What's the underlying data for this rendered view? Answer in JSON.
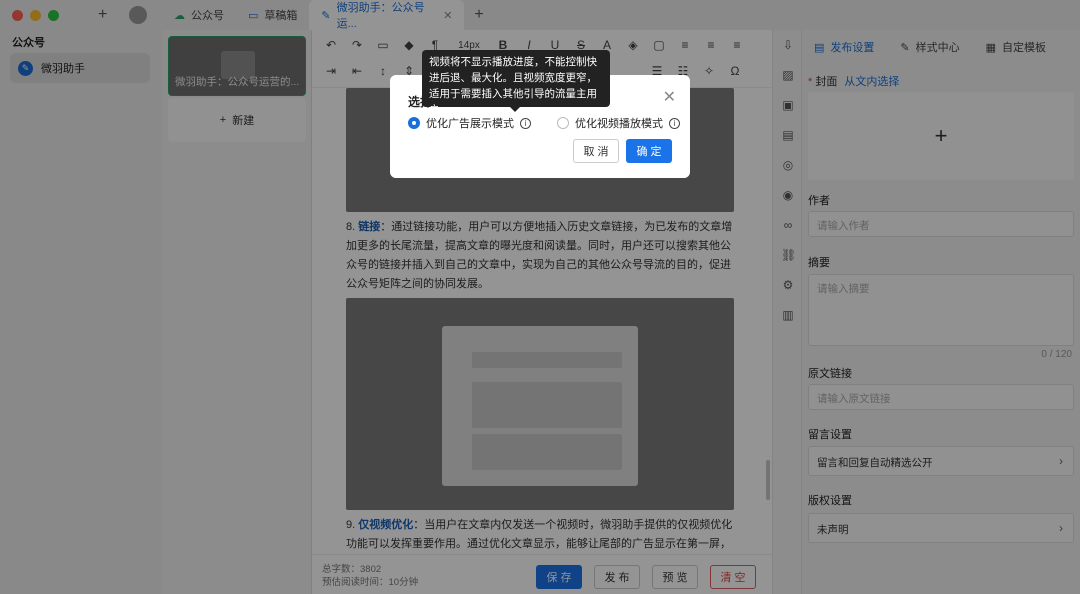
{
  "titlebar": {
    "tabs": [
      {
        "label": "公众号",
        "icon": "cloud-icon"
      },
      {
        "label": "草稿箱",
        "icon": "folder-icon"
      },
      {
        "label": "微羽助手：公众号运...",
        "icon": "edit-icon",
        "active": true
      }
    ],
    "colors": {
      "close": "#ff5f57",
      "minimize": "#febc2e",
      "maximize": "#28c840"
    }
  },
  "sidebar": {
    "title": "公众号",
    "items": [
      {
        "label": "微羽助手",
        "icon": "pen-icon"
      }
    ]
  },
  "article_list": {
    "card_title": "微羽助手：公众号运营的...",
    "new_label": "新建"
  },
  "toolbar": {
    "font_size": "14px"
  },
  "content": {
    "para8_title": "链接",
    "para8_prefix": "8. ",
    "para8_body": "：通过链接功能，用户可以方便地插入历史文章链接，为已发布的文章增加更多的长尾流量，提高文章的曝光度和阅读量。同时，用户还可以搜索其他公众号的链接并插入到自己的文章中，实现为自己的其他公众号导流的目的，促进公众号矩阵之间的协同发展。",
    "para9_prefix": "9. ",
    "para9_title": "仅视频优化",
    "para9_body": "：当用户在文章内仅发送一个视频时，微羽助手提供的仅视频优化功能可以发挥重要作用。通过优化文章显示，能够让尾部的广告显示在第一屏，有效增加广告曝光机会，提高广告收益。"
  },
  "footer": {
    "word_count": "总字数：3802",
    "read_time": "预估阅读时间：10分钟",
    "save": "保 存",
    "publish": "发 布",
    "preview": "预 览",
    "clear": "清 空"
  },
  "panel": {
    "tabs": [
      "发布设置",
      "样式中心",
      "自定模板"
    ],
    "cover_label": "封面",
    "cover_link": "从文内选择",
    "author_label": "作者",
    "author_placeholder": "请输入作者",
    "summary_label": "摘要",
    "summary_placeholder": "请输入摘要",
    "summary_counter": "0 / 120",
    "source_label": "原文链接",
    "source_placeholder": "请输入原文链接",
    "comment_label": "留言设置",
    "comment_value": "留言和回复自动精选公开",
    "copyright_label": "版权设置",
    "copyright_value": "未声明"
  },
  "modal": {
    "title": "选择",
    "option1": "优化广告展示模式",
    "option2": "优化视频播放模式",
    "cancel": "取 消",
    "ok": "确 定",
    "tooltip": "视频将不显示播放进度，不能控制快进后退、最大化。且视频宽度更窄，适用于需要插入其他引导的流量主用户。"
  }
}
